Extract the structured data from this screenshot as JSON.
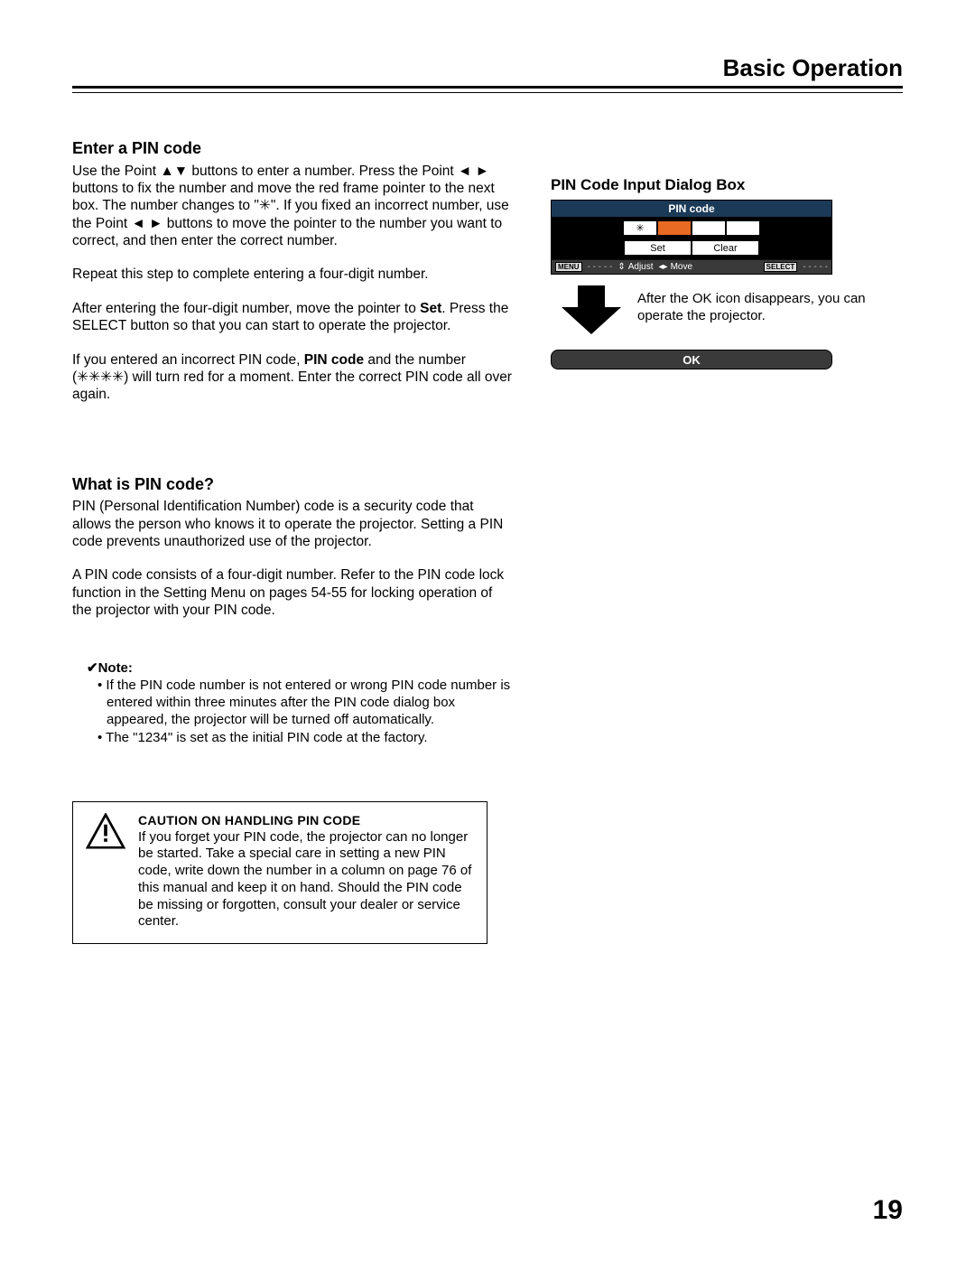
{
  "header": {
    "section_title": "Basic Operation"
  },
  "left": {
    "enter_pin_heading": "Enter a PIN code",
    "p1_a": "Use the Point ▲▼ buttons to enter a number. Press the Point ◄ ► buttons to fix the number and move the red frame pointer to the next box. The number changes to \"✳\". If you fixed an incorrect number, use the Point ◄ ► buttons to move the pointer to the number you want to correct, and then enter the correct number.",
    "p2": "Repeat this step to complete entering a four-digit number.",
    "p3_a": "After entering the four-digit number, move the pointer to ",
    "p3_bold": "Set",
    "p3_b": ". Press the SELECT button so that you can start to operate the projector.",
    "p4_a": "If you entered an incorrect PIN code, ",
    "p4_bold": "PIN code",
    "p4_b": " and the number (✳✳✳✳) will turn red for a moment. Enter the correct PIN code all over again.",
    "what_heading": "What is PIN code?",
    "what_p1": "PIN (Personal Identification Number) code is a security code that allows the person who knows it to operate the projector. Setting a PIN code prevents unauthorized use of the projector.",
    "what_p2": "A PIN code consists of a four-digit number. Refer to the PIN code lock function in the Setting Menu on pages 54-55 for locking operation of the projector with your PIN code.",
    "note_label": "✔Note:",
    "note_item1": "If the PIN code number is not entered or wrong PIN code number is entered within three minutes after the PIN code dialog box appeared, the projector will be turned off automatically.",
    "note_item2": "The \"1234\" is set as the initial PIN code at the factory.",
    "caution_title": "CAUTION ON HANDLING PIN CODE",
    "caution_body": "If you forget your PIN code, the projector can no longer be started. Take a special care in setting a new PIN code, write down the number in a column on page 76 of this manual and keep it on hand. Should the PIN code be missing or forgotten, consult your dealer or service center."
  },
  "right": {
    "heading": "PIN Code Input Dialog Box",
    "dialog": {
      "title": "PIN code",
      "digit1": "✳",
      "set_label": "Set",
      "clear_label": "Clear",
      "menu_box": "MENU",
      "menu_dashes": "- - - - -",
      "adjust_label": "Adjust",
      "move_label": "Move",
      "select_box": "SELECT",
      "select_dashes": "- - - - -"
    },
    "arrow_text": "After the OK icon disappears, you can operate the projector.",
    "ok_label": "OK"
  },
  "page_number": "19"
}
